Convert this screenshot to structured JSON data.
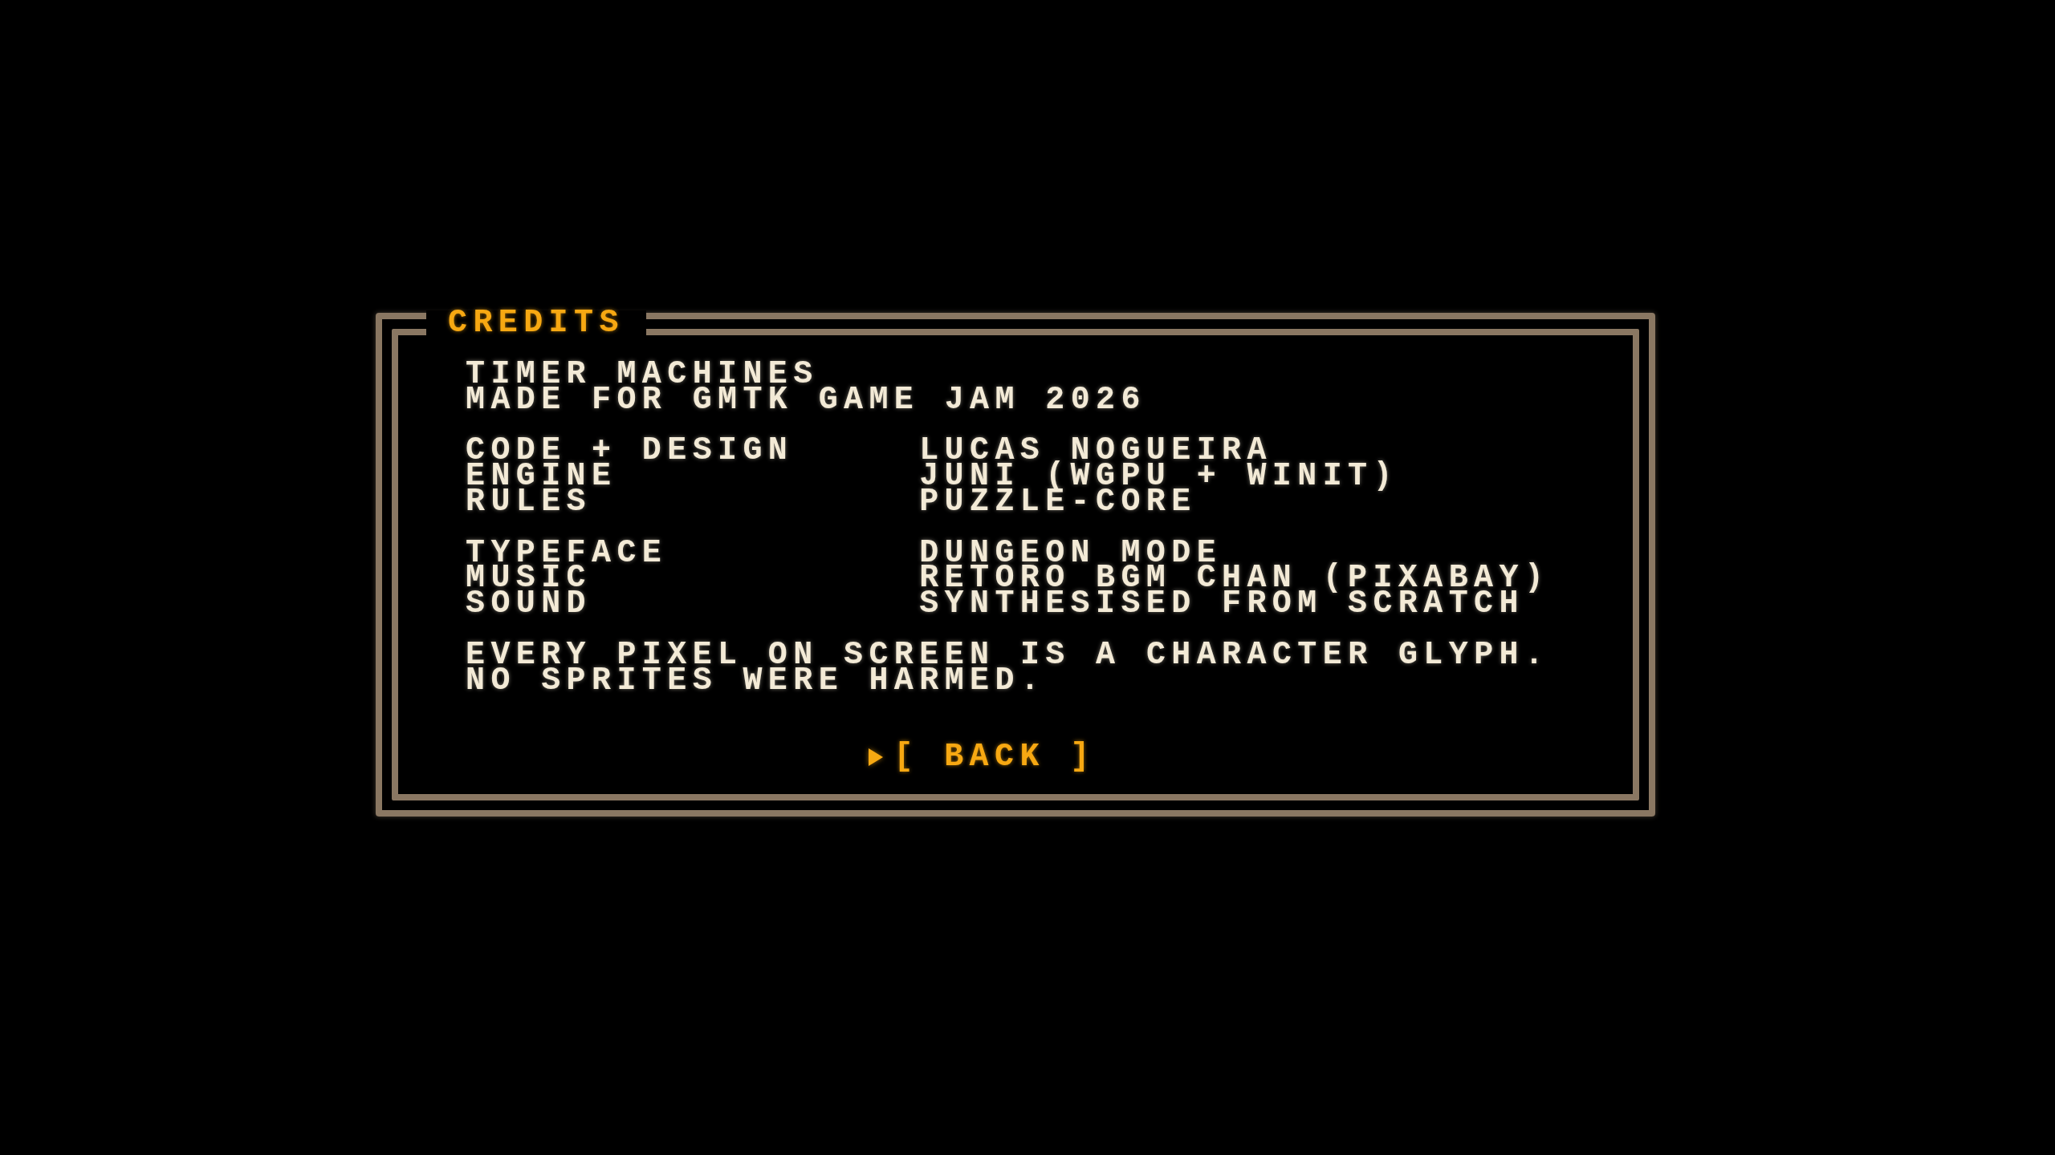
{
  "panel": {
    "title": "CREDITS"
  },
  "header_lines": [
    "TIMER MACHINES",
    "MADE FOR GMTK GAME JAM 2026"
  ],
  "credit_groups": [
    {
      "rows": [
        {
          "role": "CODE + DESIGN",
          "name": "LUCAS NOGUEIRA"
        },
        {
          "role": "ENGINE",
          "name": "JUNI (WGPU + WINIT)"
        },
        {
          "role": "RULES",
          "name": "PUZZLE-CORE"
        }
      ]
    },
    {
      "rows": [
        {
          "role": "TYPEFACE",
          "name": "DUNGEON MODE"
        },
        {
          "role": "MUSIC",
          "name": "RETORO BGM CHAN (PIXABAY)"
        },
        {
          "role": "SOUND",
          "name": "SYNTHESISED FROM SCRATCH"
        }
      ]
    }
  ],
  "footer_lines": [
    "EVERY PIXEL ON SCREEN IS A CHARACTER GLYPH.",
    "NO SPRITES WERE HARMED."
  ],
  "menu": [
    {
      "label": "[ BACK ]",
      "selected": true
    }
  ]
}
